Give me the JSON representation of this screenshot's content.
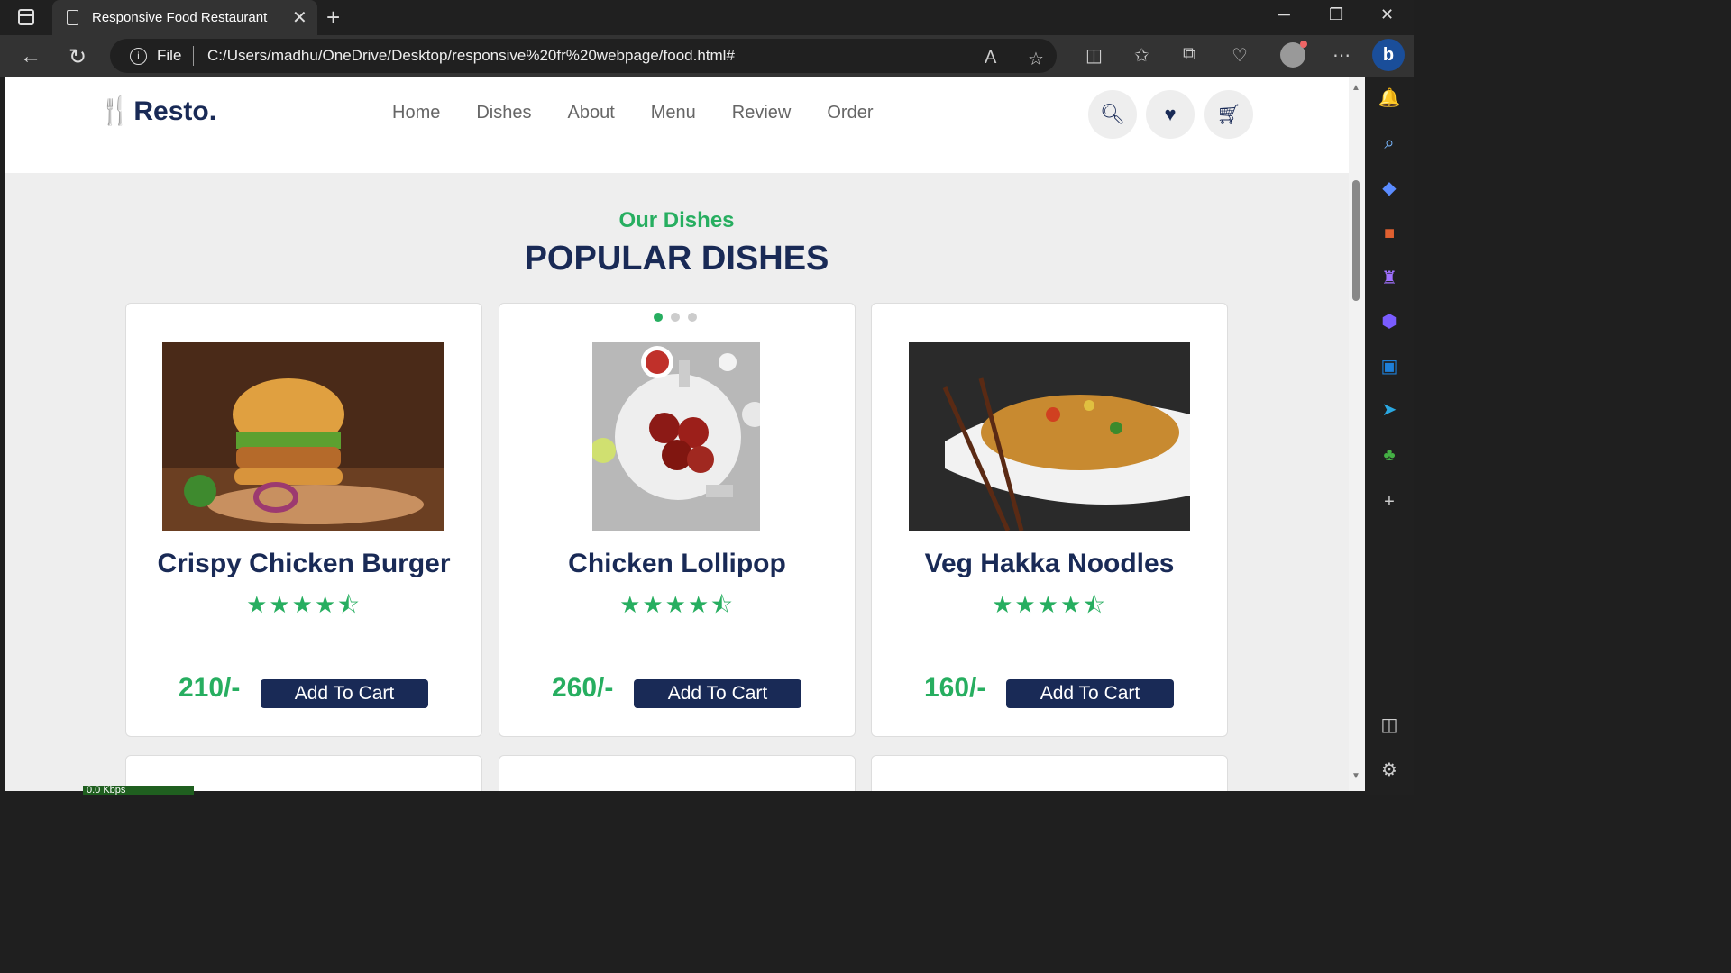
{
  "browser": {
    "tab_title": "Responsive Food Restaurant",
    "address_scheme": "File",
    "url": "C:/Users/madhu/OneDrive/Desktop/responsive%20fr%20webpage/food.html#"
  },
  "site": {
    "logo_text": "Resto.",
    "nav": [
      "Home",
      "Dishes",
      "About",
      "Menu",
      "Review",
      "Order"
    ],
    "section_subtitle": "Our Dishes",
    "section_heading": "POPULAR DISHES",
    "cards": [
      {
        "name": "Crispy Chicken Burger",
        "rating": 4.5,
        "stars": "★★★★⯪",
        "price": "210/-",
        "button": "Add To Cart"
      },
      {
        "name": "Chicken Lollipop",
        "rating": 4.5,
        "stars": "★★★★⯪",
        "price": "260/-",
        "button": "Add To Cart"
      },
      {
        "name": "Veg Hakka Noodles",
        "rating": 4.5,
        "stars": "★★★★⯪",
        "price": "160/-",
        "button": "Add To Cart"
      }
    ],
    "colors": {
      "brand": "#27ae60",
      "dark": "#192a56"
    }
  },
  "status": {
    "speed": "0.0 Kbps"
  }
}
